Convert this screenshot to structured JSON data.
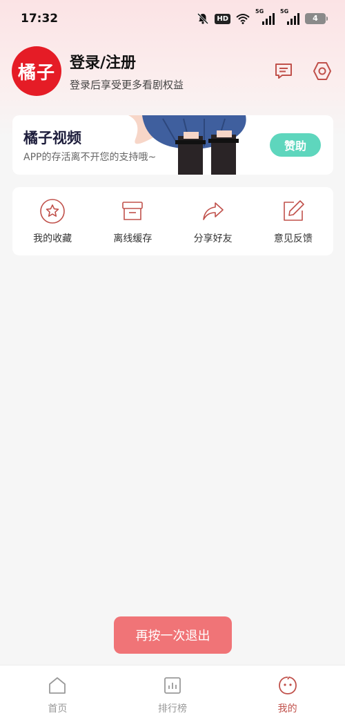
{
  "status_bar": {
    "time": "17:32",
    "hd_label": "HD",
    "net_label_1": "5G",
    "net_label_2": "5G",
    "battery": "4",
    "icons": [
      "bell-muted-icon",
      "hd-icon",
      "wifi-icon",
      "signal-icon",
      "signal-icon",
      "battery-icon"
    ]
  },
  "profile": {
    "avatar_text": "橘子",
    "title": "登录/注册",
    "subtitle": "登录后享受更多看剧权益",
    "message_icon": "message-icon",
    "settings_icon": "settings-icon"
  },
  "promo": {
    "title": "橘子视频",
    "subtitle": "APP的存活离不开您的支持哦~",
    "button": "赞助"
  },
  "actions": [
    {
      "label": "我的收藏",
      "icon": "star-icon"
    },
    {
      "label": "离线缓存",
      "icon": "archive-icon"
    },
    {
      "label": "分享好友",
      "icon": "share-icon"
    },
    {
      "label": "意见反馈",
      "icon": "edit-icon"
    }
  ],
  "toast": "再按一次退出",
  "nav": [
    {
      "label": "首页",
      "icon": "home-icon",
      "active": false
    },
    {
      "label": "排行榜",
      "icon": "chart-icon",
      "active": false
    },
    {
      "label": "我的",
      "icon": "face-icon",
      "active": true
    }
  ],
  "colors": {
    "accent": "#c0504a",
    "avatar_bg": "#e51c26",
    "sponsor_btn": "#5ed6bd",
    "toast_bg": "#f07477"
  }
}
